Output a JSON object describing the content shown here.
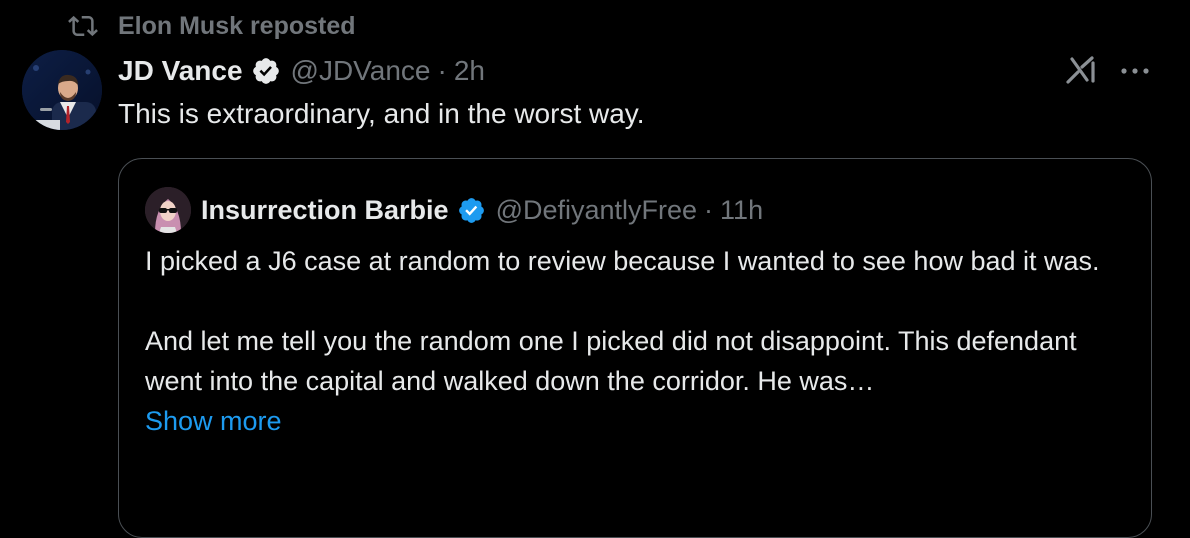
{
  "repost": {
    "label": "Elon Musk reposted",
    "icon": "repost-icon"
  },
  "tweet": {
    "author_name": "JD Vance",
    "handle": "@JDVance",
    "separator": "·",
    "time": "2h",
    "text": "This is extraordinary, and in the worst way."
  },
  "quote": {
    "author_name": "Insurrection Barbie",
    "handle": "@DefiyantlyFree",
    "separator": "·",
    "time": "11h",
    "paragraph1": "I picked a J6 case at random to review because I wanted to see how bad it was.",
    "paragraph2": "And let me tell you the random one I picked did not disappoint. This defendant went into the capital and walked down the corridor. He was…",
    "show_more": "Show more"
  },
  "colors": {
    "background": "#000000",
    "text": "#e7e9ea",
    "muted": "#71767b",
    "accent": "#1d9bf0",
    "card_border": "#4a4f54"
  },
  "icons": {
    "verified": "verified-badge-icon",
    "grok": "grok-icon",
    "more": "more-options-icon"
  }
}
